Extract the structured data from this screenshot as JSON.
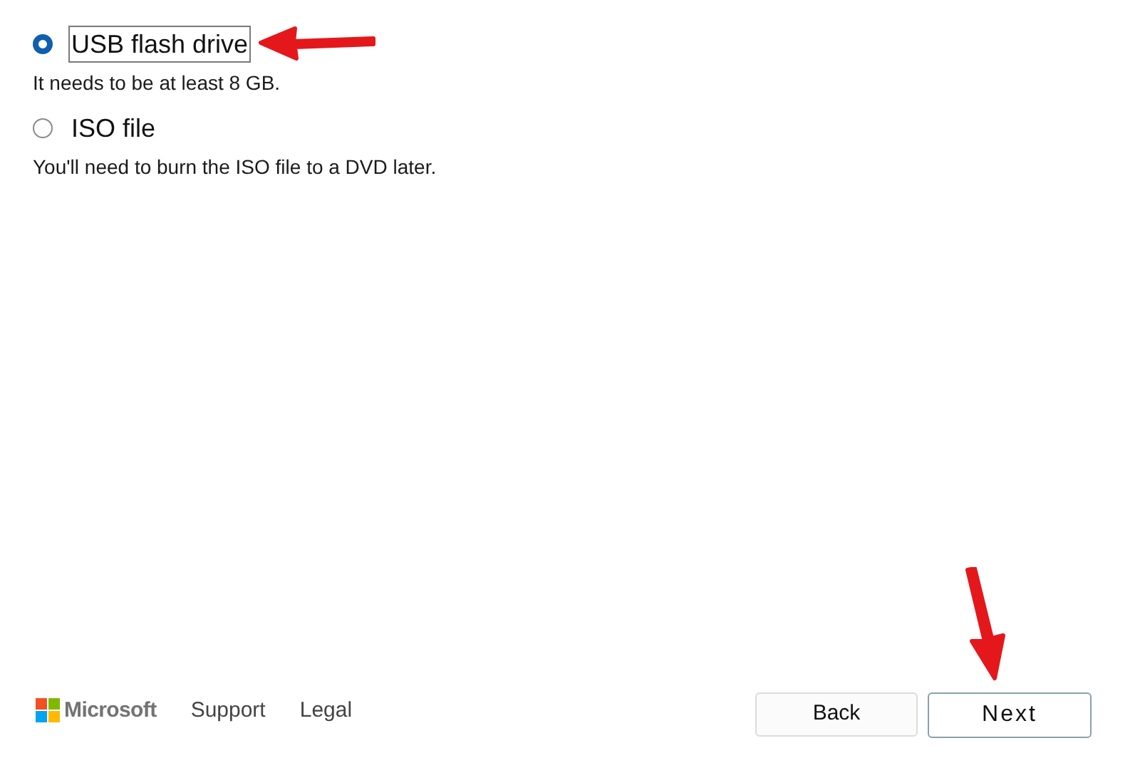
{
  "options": [
    {
      "label": "USB flash drive",
      "description": "It needs to be at least 8 GB.",
      "selected": true,
      "focused": true
    },
    {
      "label": "ISO file",
      "description": "You'll need to burn the ISO file to a DVD later.",
      "selected": false,
      "focused": false
    }
  ],
  "footer": {
    "brand": "Microsoft",
    "links": [
      "Support",
      "Legal"
    ]
  },
  "buttons": [
    {
      "label": "Back",
      "kind": "secondary"
    },
    {
      "label": "Next",
      "kind": "primary"
    }
  ]
}
